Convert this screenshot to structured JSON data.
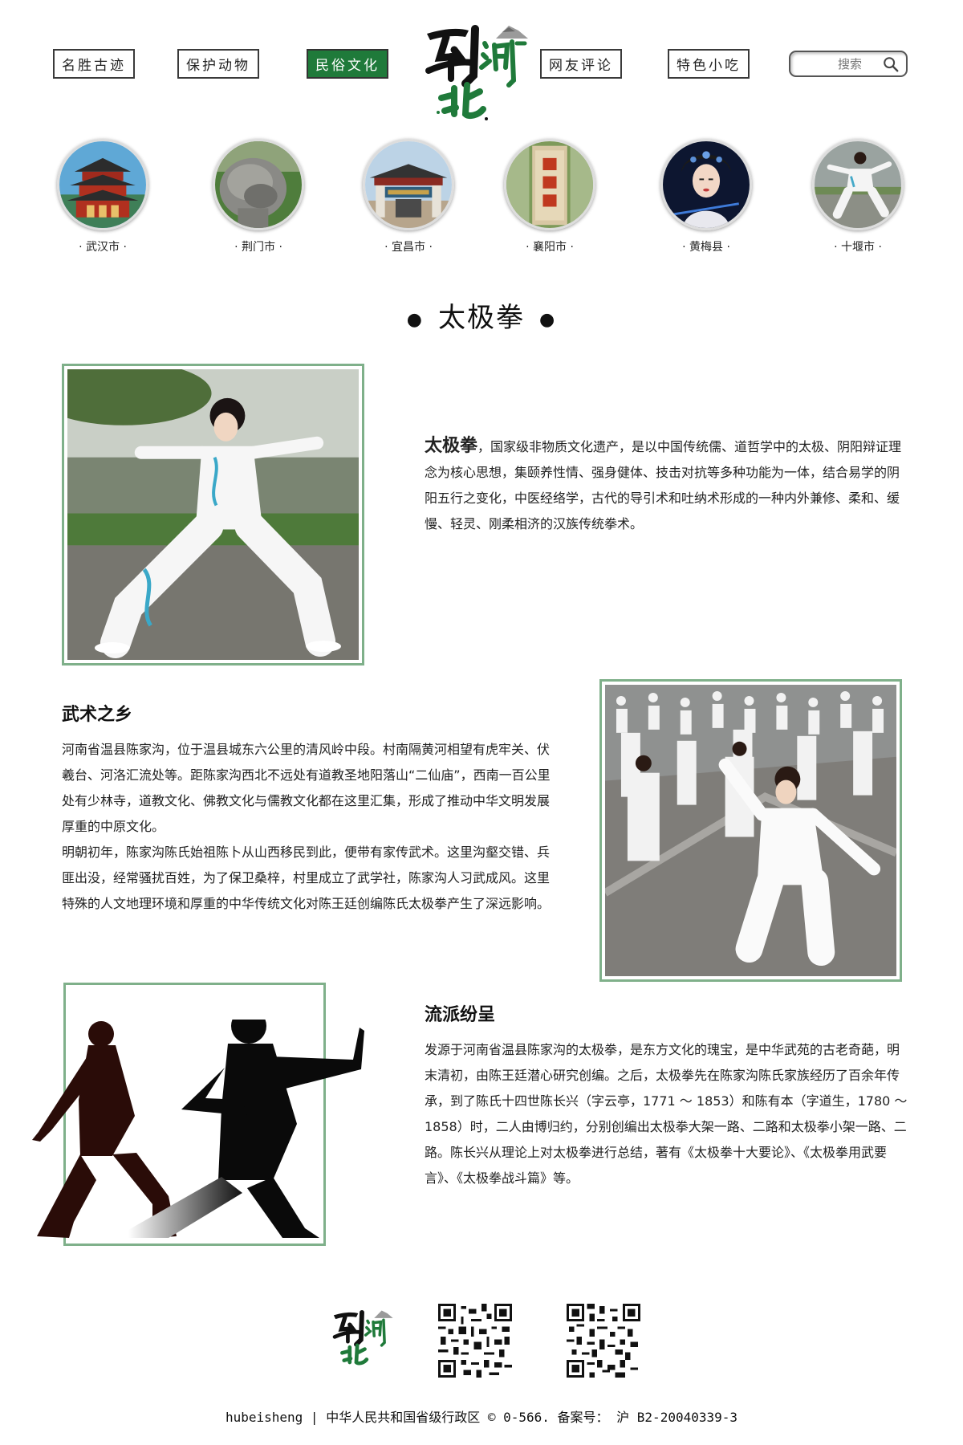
{
  "header": {
    "nav": [
      {
        "label": "名胜古迹",
        "active": false
      },
      {
        "label": "保护动物",
        "active": false
      },
      {
        "label": "民俗文化",
        "active": true
      },
      {
        "label": "网友评论",
        "active": false
      },
      {
        "label": "特色小吃",
        "active": false
      }
    ],
    "search_placeholder": "搜索",
    "logo_text": "到湖北"
  },
  "cities": [
    {
      "label": "· 武汉市 ·",
      "icon": "yellow-crane-tower"
    },
    {
      "label": "· 荆门市 ·",
      "icon": "stone-turtle"
    },
    {
      "label": "· 宜昌市 ·",
      "icon": "temple-gate"
    },
    {
      "label": "· 襄阳市 ·",
      "icon": "wolong-stone-tablet"
    },
    {
      "label": "· 黄梅县 ·",
      "icon": "opera-performer"
    },
    {
      "label": "· 十堰市 ·",
      "icon": "taiji-performer"
    }
  ],
  "section": {
    "title": "太极拳"
  },
  "intro": {
    "head": "太极拳",
    "text": "，国家级非物质文化遗产，是以中国传统儒、道哲学中的太极、阴阳辩证理念为核心思想，集颐养性情、强身健体、技击对抗等多种功能为一体，结合易学的阴阳五行之变化，中医经络学，古代的导引术和吐纳术形成的一种内外兼修、柔和、缓慢、轻灵、刚柔相济的汉族传统拳术。"
  },
  "hometown": {
    "title": "武术之乡",
    "p1": "河南省温县陈家沟，位于温县城东六公里的清风岭中段。村南隔黄河相望有虎牢关、伏羲台、河洛汇流处等。距陈家沟西北不远处有道教圣地阳落山“二仙庙”，西南一百公里处有少林寺，道教文化、佛教文化与儒教文化都在这里汇集，形成了推动中华文明发展厚重的中原文化。",
    "p2": "明朝初年，陈家沟陈氏始祖陈卜从山西移民到此，便带有家传武术。这里沟壑交错、兵匪出没，经常骚扰百姓，为了保卫桑梓，村里成立了武学社，陈家沟人习武成风。这里特殊的人文地理环境和厚重的中华传统文化对陈王廷创编陈氏太极拳产生了深远影响。"
  },
  "schools": {
    "title": "流派纷呈",
    "text": "发源于河南省温县陈家沟的太极拳，是东方文化的瑰宝，是中华武苑的古老奇葩，明末清初，由陈王廷潜心研究创编。之后，太极拳先在陈家沟陈氏家族经历了百余年传承，到了陈氏十四世陈长兴（字云亭，1771 ～ 1853）和陈有本（字道生，1780 ～ 1858）时，二人由博归约，分别创编出太极拳大架一路、二路和太极拳小架一路、二路。陈长兴从理论上对太极拳进行总结，著有《太极拳十大要论》、《太极拳用武要言》、《太极拳战斗篇》等。"
  },
  "footer": {
    "text": "hubeisheng | 中华人民共和国省级行政区 © 0-566. 备案号： 沪 B2-20040339-3"
  },
  "colors": {
    "accent": "#1f7a3a",
    "frame": "#7fb08a"
  }
}
